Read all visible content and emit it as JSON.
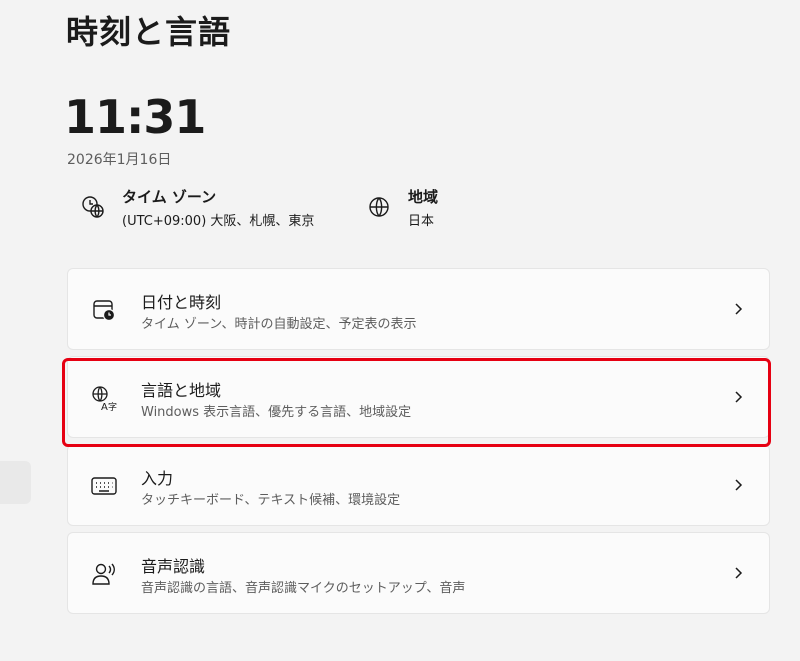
{
  "header": {
    "title": "時刻と言語"
  },
  "clock": {
    "time": "11:31",
    "date": "2026年1月16日"
  },
  "info": {
    "timezone": {
      "label": "タイム ゾーン",
      "value": "(UTC+09:00) 大阪、札幌、東京",
      "icon": "clock-globe-icon"
    },
    "region": {
      "label": "地域",
      "value": "日本",
      "icon": "globe-icon"
    }
  },
  "cards": [
    {
      "title": "日付と時刻",
      "subtitle": "タイム ゾーン、時計の自動設定、予定表の表示",
      "icon": "calendar-clock-icon"
    },
    {
      "title": "言語と地域",
      "subtitle": "Windows 表示言語、優先する言語、地域設定",
      "icon": "language-icon"
    },
    {
      "title": "入力",
      "subtitle": "タッチキーボード、テキスト候補、環境設定",
      "icon": "keyboard-icon"
    },
    {
      "title": "音声認識",
      "subtitle": "音声認識の言語、音声認識マイクのセットアップ、音声",
      "icon": "speech-icon"
    }
  ],
  "colors": {
    "background": "#f3f3f3",
    "card": "#fbfbfb",
    "highlight": "#e60012"
  }
}
